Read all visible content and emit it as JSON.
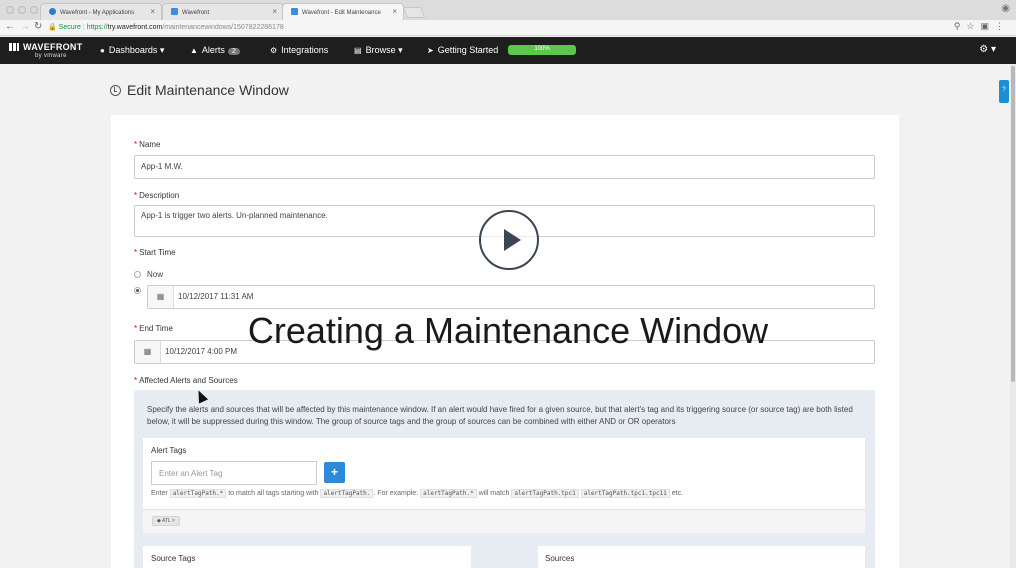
{
  "browser": {
    "tabs": [
      {
        "title": "Wavefront - My Applications",
        "favicon_color": "#2d7bd0"
      },
      {
        "title": "Wavefront",
        "favicon_color": "#3a8de0"
      },
      {
        "title": "Wavefront - Edit Maintenance",
        "favicon_color": "#3a8de0"
      }
    ],
    "url": {
      "secure_label": "Secure",
      "scheme": "https://",
      "host": "try.wavefront.com",
      "path": "/maintenancewindows/1507822286178"
    }
  },
  "appnav": {
    "logo": "WAVEFRONT",
    "logo_sub": "by vmware",
    "items": {
      "dashboards": "Dashboards",
      "alerts": "Alerts",
      "alerts_count": "2",
      "integrations": "Integrations",
      "browse": "Browse",
      "getting_started": "Getting Started",
      "progress_text": "100%"
    },
    "progress": 1.0
  },
  "page": {
    "title": "Edit Maintenance Window",
    "help": "?"
  },
  "form": {
    "name_label": "Name",
    "name_value": "App-1 M.W.",
    "description_label": "Description",
    "description_value": "App-1 is trigger two alerts. Un-planned maintenance.",
    "start_label": "Start Time",
    "start_now": "Now",
    "start_value": "10/12/2017 11:31 AM",
    "end_label": "End Time",
    "end_value": "10/12/2017 4:00 PM",
    "affected_label": "Affected Alerts and Sources",
    "affected_text": "Specify the alerts and sources that will be affected by this maintenance window. If an alert would have fired for a given source, but that alert's tag and its triggering source (or source tag) are both listed below, it will be suppressed during this window. The group of source tags and the group of sources can be combined with either AND or OR operators",
    "alert_tags_title": "Alert Tags",
    "alert_tag_placeholder": "Enter an Alert Tag",
    "add_button": "+",
    "hint": {
      "enter": "Enter",
      "code1": "alertTagPath.*",
      "mid1": "to match all tags starting with",
      "code2": "alertTagPath.",
      "mid2": ". For example:",
      "code3": "alertTagPath.*",
      "mid3": "will match",
      "code4": "alertTagPath.tpc1",
      "code5": "alertTagPath.tpc1.tpc11",
      "end": "etc."
    },
    "chip": "ATL",
    "source_tags_title": "Source Tags",
    "sources_title": "Sources"
  },
  "overlay": {
    "caption": "Creating a Maintenance Window"
  }
}
